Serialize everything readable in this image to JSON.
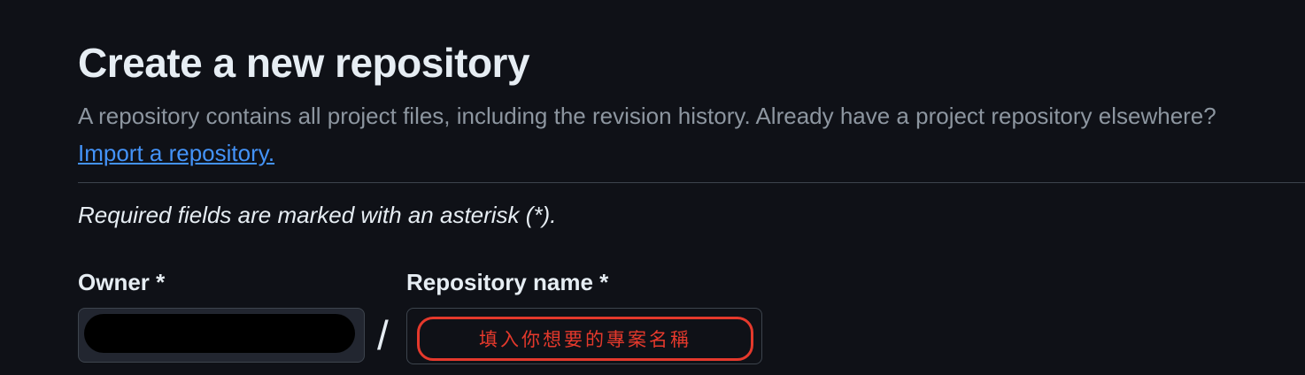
{
  "header": {
    "title": "Create a new repository",
    "description": "A repository contains all project files, including the revision history. Already have a project repository elsewhere?",
    "import_link": "Import a repository."
  },
  "form": {
    "required_note": "Required fields are marked with an asterisk (*).",
    "owner_label": "Owner *",
    "separator": "/",
    "repo_name_label": "Repository name *",
    "annotation": "填入你想要的專案名稱"
  },
  "colors": {
    "accent": "#4493f8",
    "annotation": "#e5392c",
    "background": "#0f1117"
  }
}
